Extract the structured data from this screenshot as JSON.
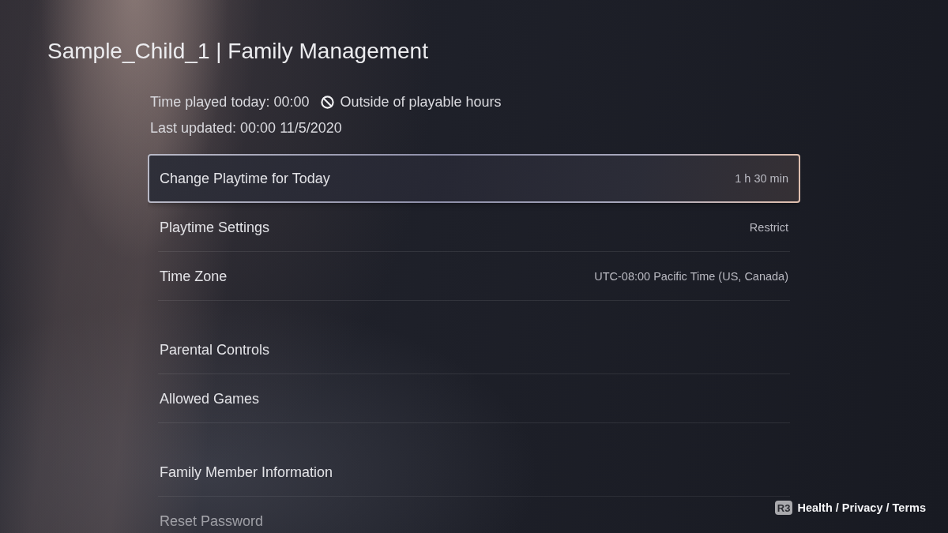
{
  "header": {
    "title": "Sample_Child_1 | Family Management"
  },
  "status": {
    "time_played": "Time played today: 00:00",
    "playable_status": "Outside of playable hours",
    "last_updated": "Last updated: 00:00 11/5/2020"
  },
  "menu_groups": [
    {
      "items": [
        {
          "label": "Change Playtime for Today",
          "value": "1 h 30 min",
          "selected": true
        },
        {
          "label": "Playtime Settings",
          "value": "Restrict",
          "selected": false
        },
        {
          "label": "Time Zone",
          "value": "UTC-08:00 Pacific Time (US, Canada)",
          "selected": false
        }
      ]
    },
    {
      "items": [
        {
          "label": "Parental Controls",
          "selected": false
        },
        {
          "label": "Allowed Games",
          "selected": false
        }
      ]
    },
    {
      "items": [
        {
          "label": "Family Member Information",
          "selected": false
        },
        {
          "label": "Reset Password",
          "selected": false
        }
      ]
    }
  ],
  "footer": {
    "button": "R3",
    "link": "Health / Privacy / Terms"
  }
}
